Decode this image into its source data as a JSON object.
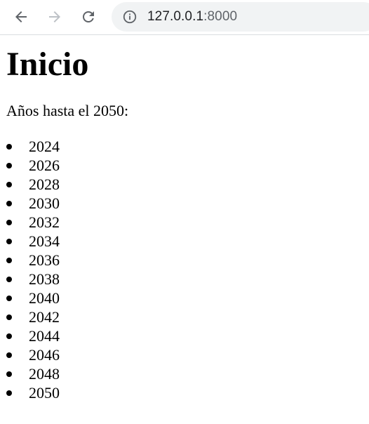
{
  "browser": {
    "url_host": "127.0.0.1",
    "url_port": ":8000",
    "icons": {
      "back": "arrow-left-icon",
      "forward": "arrow-right-icon",
      "reload": "reload-icon",
      "info": "info-icon"
    }
  },
  "page": {
    "title": "Inicio",
    "intro": "Años hasta el 2050:",
    "years": [
      "2024",
      "2026",
      "2028",
      "2030",
      "2032",
      "2034",
      "2036",
      "2038",
      "2040",
      "2042",
      "2044",
      "2046",
      "2048",
      "2050"
    ]
  },
  "colors": {
    "toolbar_icon": "#5f6368",
    "disabled_icon": "#bdc1c6",
    "omnibox_bg": "#f1f3f4",
    "text": "#000000"
  }
}
